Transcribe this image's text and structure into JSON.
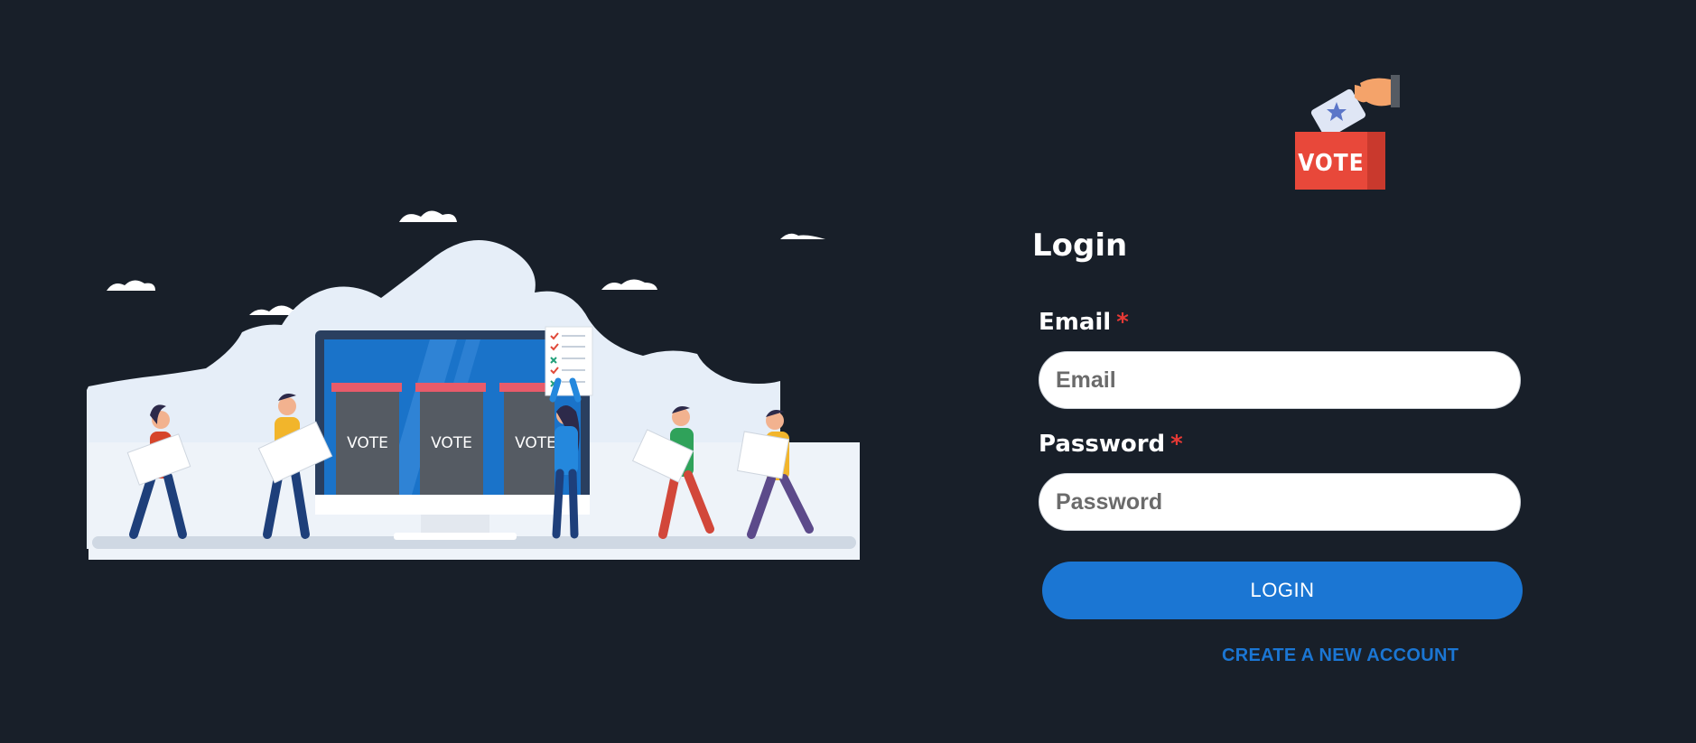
{
  "illustration": {
    "ballot_box_label": "VOTE"
  },
  "logo": {
    "text": "VOTE"
  },
  "form": {
    "title": "Login",
    "email": {
      "label": "Email",
      "required_mark": "*",
      "placeholder": "Email",
      "value": ""
    },
    "password": {
      "label": "Password",
      "required_mark": "*",
      "placeholder": "Password",
      "value": ""
    },
    "login_button": "LOGIN",
    "create_account_link": "CREATE A NEW ACCOUNT"
  },
  "colors": {
    "background": "#181f29",
    "accent": "#1b76d3",
    "required": "#e53935",
    "logo_box": "#e8483a"
  }
}
